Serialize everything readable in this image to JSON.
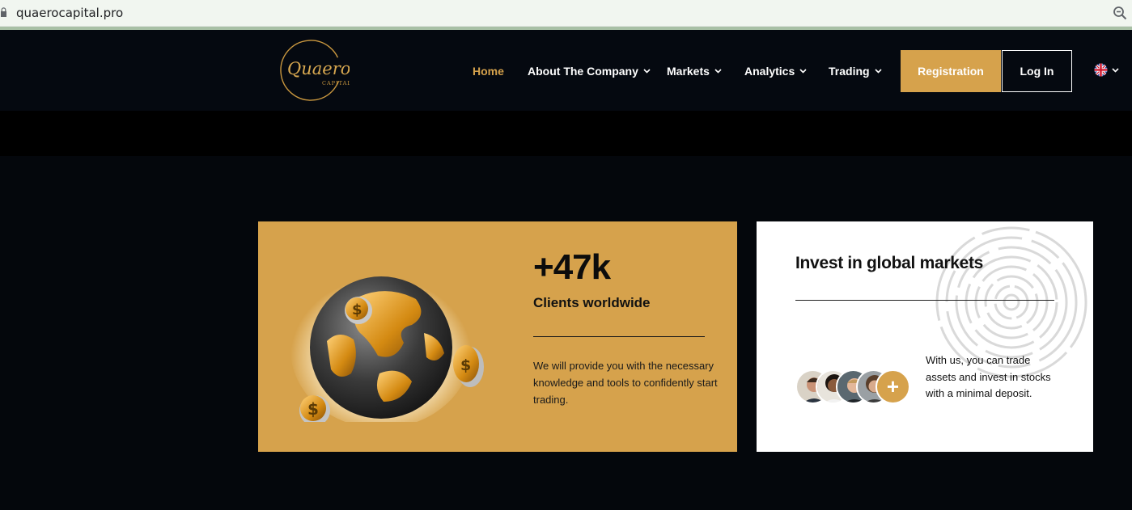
{
  "browser": {
    "url": "quaerocapital.pro",
    "icons": {
      "lock": "lock-icon",
      "zoom": "zoom-icon"
    }
  },
  "header": {
    "logo_text": "Quaero",
    "logo_subtext": "CAPITAL",
    "nav": {
      "home": "Home",
      "about": "About The Company",
      "markets": "Markets",
      "analytics": "Analytics",
      "trading": "Trading"
    },
    "registration_label": "Registration",
    "login_label": "Log In",
    "language_icon": "uk-flag-icon"
  },
  "stats_card": {
    "number": "+47k",
    "label": "Clients worldwide",
    "description": "We will provide you with the necessary knowledge and tools to confidently start trading."
  },
  "invest_card": {
    "title": "Invest in global markets",
    "description": "With us, you can trade assets and invest in stocks with a minimal deposit.",
    "plus_label": "+"
  },
  "colors": {
    "accent": "#d6a24c",
    "background": "#04070c",
    "card_white": "#ffffff"
  }
}
